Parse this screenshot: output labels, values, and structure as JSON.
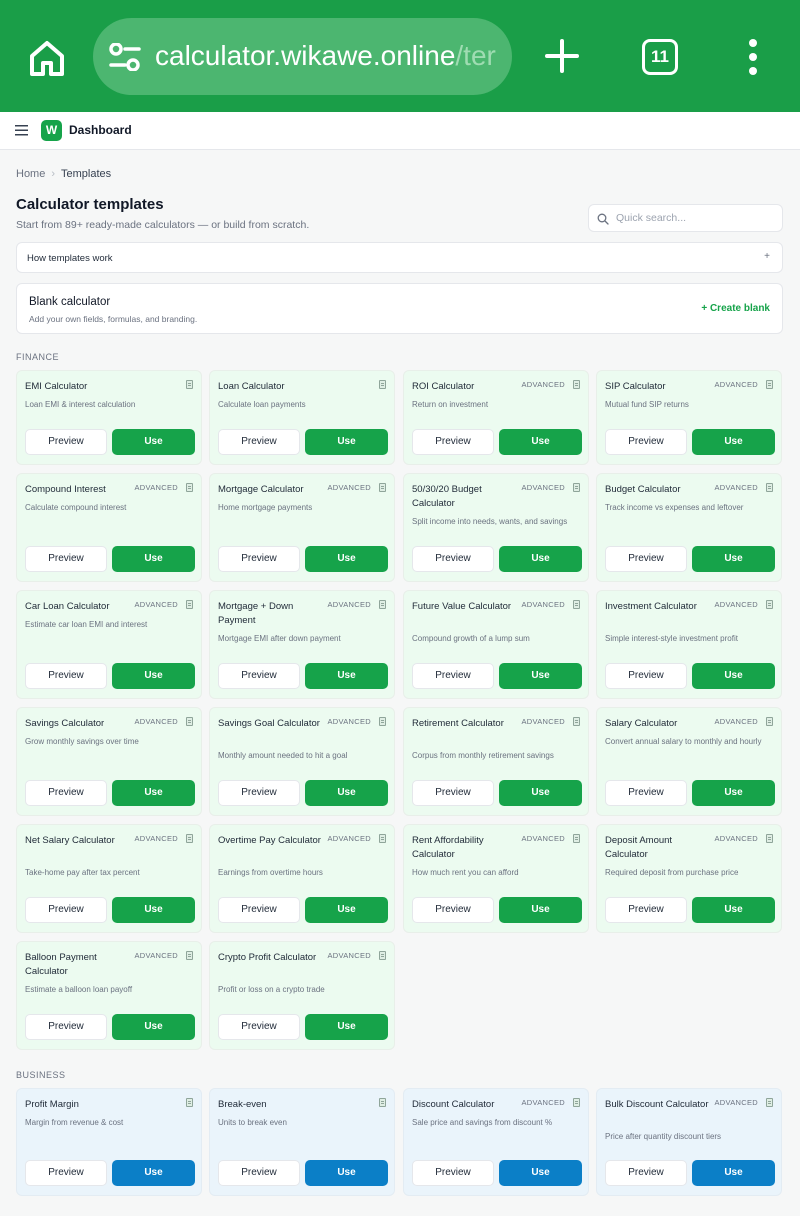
{
  "browser": {
    "url_host": "calculator.wikawe.online",
    "url_path": "/ter",
    "tab_count": "11"
  },
  "app": {
    "logo_letter": "W",
    "title": "Dashboard"
  },
  "breadcrumb": {
    "home": "Home",
    "current": "Templates"
  },
  "page": {
    "title": "Calculator templates",
    "subtitle": "Start from 89+ ready-made calculators — or build from scratch."
  },
  "search": {
    "placeholder": "Quick search..."
  },
  "how": {
    "label": "How templates work",
    "toggle": "+"
  },
  "blank": {
    "title": "Blank calculator",
    "subtitle": "Add your own fields, formulas, and branding.",
    "action": "+ Create blank"
  },
  "labels": {
    "preview": "Preview",
    "use": "Use",
    "advanced": "ADVANCED"
  },
  "sections": [
    {
      "name": "FINANCE",
      "kind": "fin",
      "cards": [
        {
          "title": "EMI Calculator",
          "desc": "Loan EMI & interest calculation",
          "advanced": false
        },
        {
          "title": "Loan Calculator",
          "desc": "Calculate loan payments",
          "advanced": false
        },
        {
          "title": "ROI Calculator",
          "desc": "Return on investment",
          "advanced": true
        },
        {
          "title": "SIP Calculator",
          "desc": "Mutual fund SIP returns",
          "advanced": true
        },
        {
          "title": "Compound Interest",
          "desc": "Calculate compound interest",
          "advanced": true
        },
        {
          "title": "Mortgage Calculator",
          "desc": "Home mortgage payments",
          "advanced": true
        },
        {
          "title": "50/30/20 Budget Calculator",
          "desc": "Split income into needs, wants, and savings",
          "advanced": true
        },
        {
          "title": "Budget Calculator",
          "desc": "Track income vs expenses and leftover",
          "advanced": true
        },
        {
          "title": "Car Loan Calculator",
          "desc": "Estimate car loan EMI and interest",
          "advanced": true
        },
        {
          "title": "Mortgage + Down Payment",
          "desc": "Mortgage EMI after down payment",
          "advanced": true
        },
        {
          "title": "Future Value Calculator",
          "desc": "Compound growth of a lump sum",
          "advanced": true
        },
        {
          "title": "Investment Calculator",
          "desc": "Simple interest-style investment profit",
          "advanced": true
        },
        {
          "title": "Savings Calculator",
          "desc": "Grow monthly savings over time",
          "advanced": true
        },
        {
          "title": "Savings Goal Calculator",
          "desc": "Monthly amount needed to hit a goal",
          "advanced": true
        },
        {
          "title": "Retirement Calculator",
          "desc": "Corpus from monthly retirement savings",
          "advanced": true
        },
        {
          "title": "Salary Calculator",
          "desc": "Convert annual salary to monthly and hourly",
          "advanced": true
        },
        {
          "title": "Net Salary Calculator",
          "desc": "Take-home pay after tax percent",
          "advanced": true
        },
        {
          "title": "Overtime Pay Calculator",
          "desc": "Earnings from overtime hours",
          "advanced": true
        },
        {
          "title": "Rent Affordability Calculator",
          "desc": "How much rent you can afford",
          "advanced": true
        },
        {
          "title": "Deposit Amount Calculator",
          "desc": "Required deposit from purchase price",
          "advanced": true
        },
        {
          "title": "Balloon Payment Calculator",
          "desc": "Estimate a balloon loan payoff",
          "advanced": true
        },
        {
          "title": "Crypto Profit Calculator",
          "desc": "Profit or loss on a crypto trade",
          "advanced": true
        }
      ]
    },
    {
      "name": "BUSINESS",
      "kind": "biz",
      "cards": [
        {
          "title": "Profit Margin",
          "desc": "Margin from revenue & cost",
          "advanced": false
        },
        {
          "title": "Break-even",
          "desc": "Units to break even",
          "advanced": false
        },
        {
          "title": "Discount Calculator",
          "desc": "Sale price and savings from discount %",
          "advanced": true
        },
        {
          "title": "Bulk Discount Calculator",
          "desc": "Price after quantity discount tiers",
          "advanced": true
        }
      ]
    }
  ]
}
